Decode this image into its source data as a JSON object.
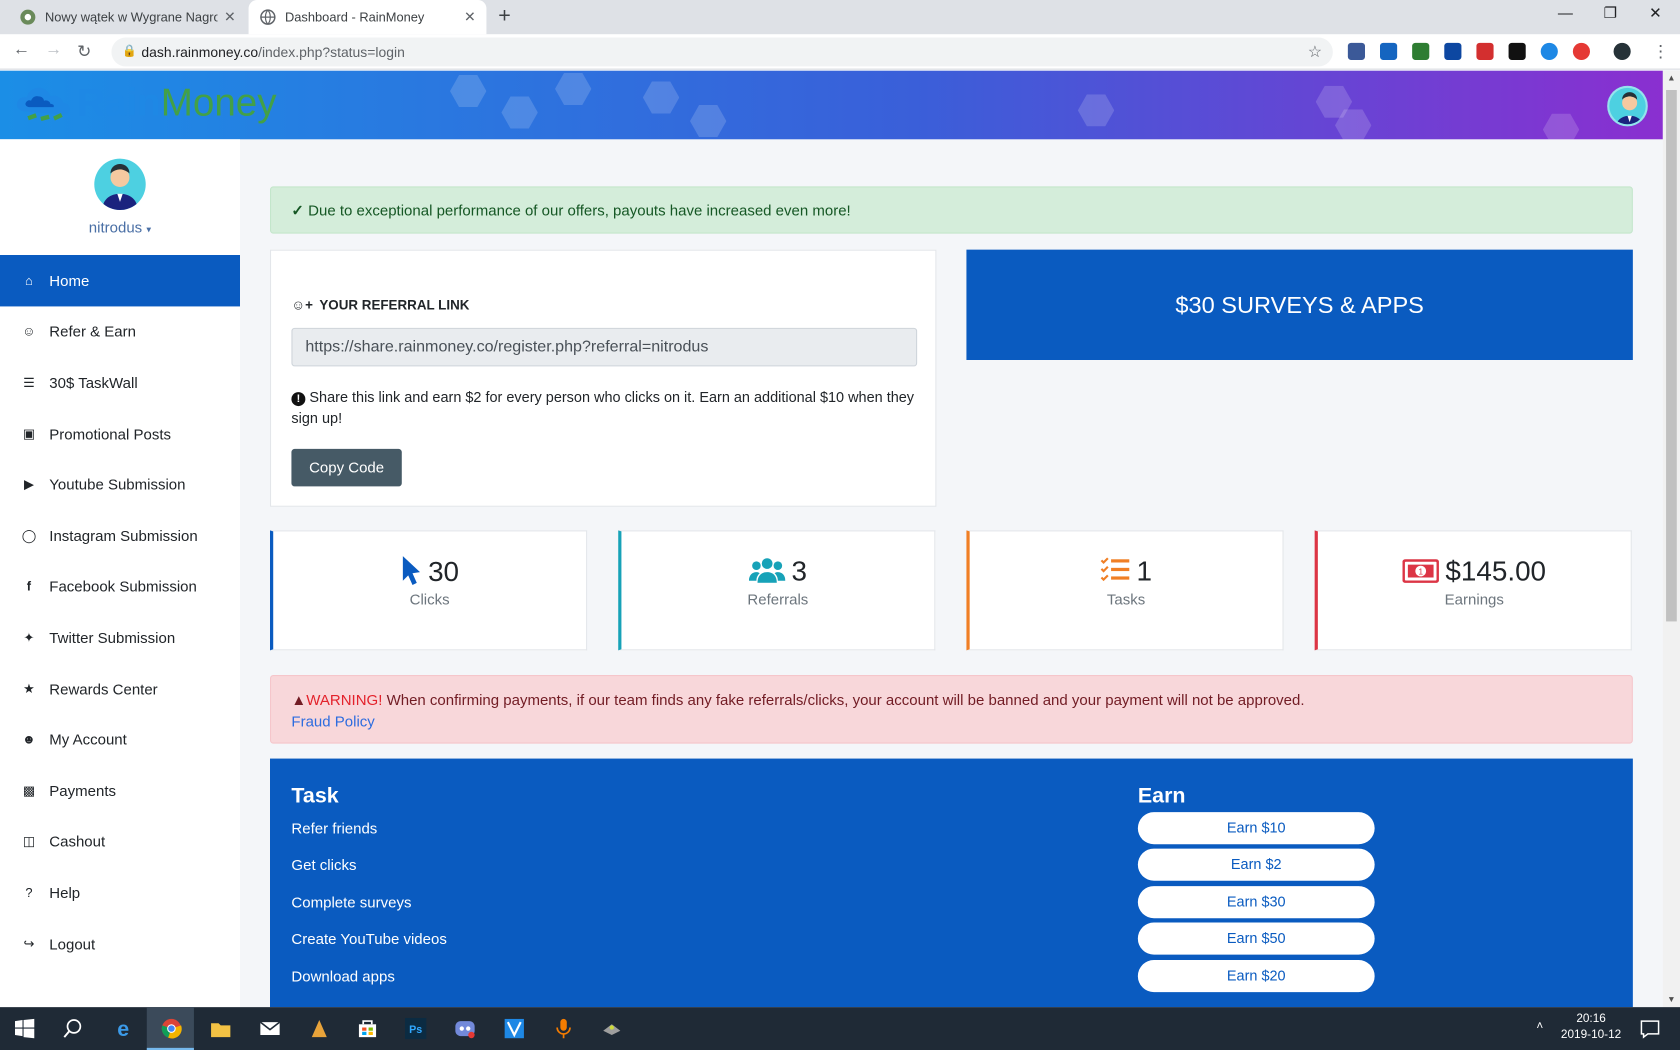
{
  "browser": {
    "tabs": [
      {
        "title": "Nowy wątek w Wygrane Nagrody",
        "active": false
      },
      {
        "title": "Dashboard - RainMoney",
        "active": true
      }
    ],
    "url_domain": "dash.rainmoney.co",
    "url_path": "/index.php?status=login"
  },
  "header": {
    "logo_part1": "Rain",
    "logo_part2": "Money"
  },
  "sidebar": {
    "username": "nitrodus",
    "items": [
      {
        "label": "Home",
        "icon": "home-icon",
        "active": true
      },
      {
        "label": "Refer & Earn",
        "icon": "users-icon"
      },
      {
        "label": "30$ TaskWall",
        "icon": "tasks-icon"
      },
      {
        "label": "Promotional Posts",
        "icon": "image-icon"
      },
      {
        "label": "Youtube Submission",
        "icon": "youtube-icon"
      },
      {
        "label": "Instagram Submission",
        "icon": "instagram-icon"
      },
      {
        "label": "Facebook Submission",
        "icon": "facebook-icon"
      },
      {
        "label": "Twitter Submission",
        "icon": "twitter-icon"
      },
      {
        "label": "Rewards Center",
        "icon": "trophy-icon"
      },
      {
        "label": "My Account",
        "icon": "user-icon"
      },
      {
        "label": "Payments",
        "icon": "money-icon"
      },
      {
        "label": "Cashout",
        "icon": "file-icon"
      },
      {
        "label": "Help",
        "icon": "question-icon"
      },
      {
        "label": "Logout",
        "icon": "logout-icon"
      }
    ]
  },
  "alert_success": "Due to exceptional performance of our offers, payouts have increased even more!",
  "referral": {
    "title": "YOUR REFERRAL LINK",
    "link": "https://share.rainmoney.co/register.php?referral=nitrodus",
    "note": "Share this link and earn $2 for every person who clicks on it. Earn an additional $10 when they sign up!",
    "button": "Copy Code"
  },
  "surveys_banner": "$30 SURVEYS & APPS",
  "stats": [
    {
      "value": "30",
      "label": "Clicks",
      "color": "#0a5bc0",
      "icon": "pointer-icon"
    },
    {
      "value": "3",
      "label": "Referrals",
      "color": "#17a2b8",
      "icon": "users-icon"
    },
    {
      "value": "1",
      "label": "Tasks",
      "color": "#f07f25",
      "icon": "list-check-icon"
    },
    {
      "value": "$145.00",
      "label": "Earnings",
      "color": "#dc3545",
      "icon": "money-bill-icon"
    }
  ],
  "warning": {
    "prefix": "WARNING!",
    "text": " When confirming payments, if our team finds any fake referrals/clicks, your account will be banned and your payment will not be approved.",
    "link": "Fraud Policy"
  },
  "tasks": {
    "task_header": "Task",
    "earn_header": "Earn",
    "rows": [
      {
        "task": "Refer friends",
        "earn": "Earn $10"
      },
      {
        "task": "Get clicks",
        "earn": "Earn $2"
      },
      {
        "task": "Complete surveys",
        "earn": "Earn $30"
      },
      {
        "task": "Create YouTube videos",
        "earn": "Earn $50"
      },
      {
        "task": "Download apps",
        "earn": "Earn $20"
      }
    ]
  },
  "taskbar": {
    "time": "20:16",
    "date": "2019-10-12"
  },
  "colors": {
    "primary": "#0a5bc0",
    "success_bg": "#d4edda",
    "danger_bg": "#f8d7da"
  }
}
